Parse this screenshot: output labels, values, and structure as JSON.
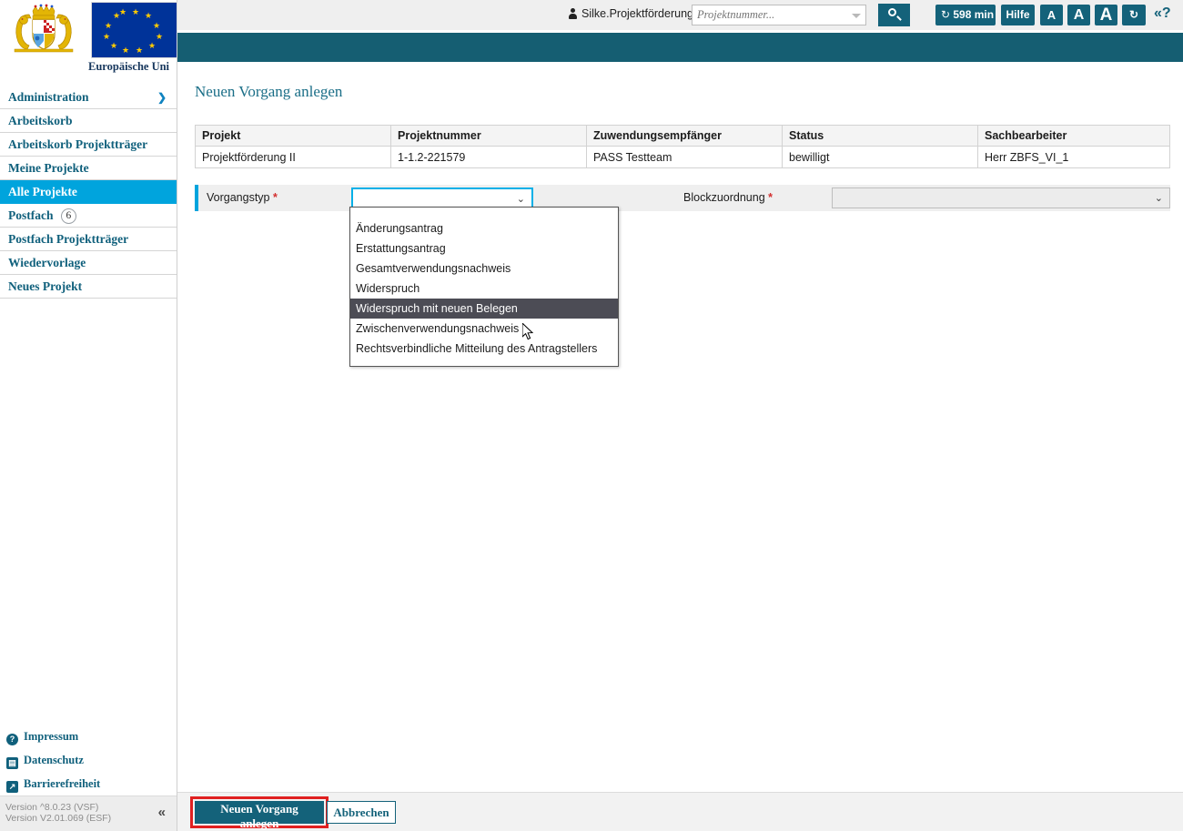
{
  "branding": {
    "eu_caption": "Europäische Uni",
    "crest_alt": "bavaria-coat-of-arms",
    "flag_alt": "eu-flag"
  },
  "topbar": {
    "user_name": "Silke.Projektförderung",
    "search_placeholder": "Projektnummer...",
    "search_value": "",
    "search_button_icon": "search-icon",
    "session_timer": "598 min",
    "help_label": "Hilfe",
    "font_small": "A",
    "font_medium": "A",
    "font_large": "A",
    "refresh_icon": "↻",
    "timer_icon": "↻",
    "collapse_help": "«?"
  },
  "sidebar": {
    "items": [
      {
        "label": "Administration",
        "badge": "",
        "chevron": "❯",
        "active": false
      },
      {
        "label": "Arbeitskorb",
        "badge": "",
        "chevron": "",
        "active": false
      },
      {
        "label": "Arbeitskorb Projektträger",
        "badge": "",
        "chevron": "",
        "active": false
      },
      {
        "label": "Meine Projekte",
        "badge": "",
        "chevron": "",
        "active": false
      },
      {
        "label": "Alle Projekte",
        "badge": "",
        "chevron": "",
        "active": true
      },
      {
        "label": "Postfach",
        "badge": "6",
        "chevron": "",
        "active": false
      },
      {
        "label": "Postfach Projektträger",
        "badge": "",
        "chevron": "",
        "active": false
      },
      {
        "label": "Wiedervorlage",
        "badge": "",
        "chevron": "",
        "active": false
      },
      {
        "label": "Neues Projekt",
        "badge": "",
        "chevron": "",
        "active": false
      }
    ],
    "footer_links": [
      {
        "label": "Impressum",
        "icon": "question-mark-icon",
        "glyph": "?"
      },
      {
        "label": "Datenschutz",
        "icon": "document-lock-icon",
        "glyph": "▤"
      },
      {
        "label": "Barrierefreiheit",
        "icon": "accessibility-arrow-icon",
        "glyph": "↗"
      }
    ],
    "version_line1": "Version ^8.0.23 (VSF)",
    "version_line2": "Version V2.01.069 (ESF)",
    "collapse_icon": "«"
  },
  "main": {
    "page_title": "Neuen Vorgang anlegen",
    "table": {
      "columns": [
        "Projekt",
        "Projektnummer",
        "Zuwendungsempfänger",
        "Status",
        "Sachbearbeiter"
      ],
      "rows": [
        [
          "Projektförderung II",
          "1-1.2-221579",
          "PASS Testteam",
          "bewilligt",
          "Herr ZBFS_VI_1"
        ]
      ]
    },
    "form": {
      "vorgangstyp_label": "Vorgangstyp",
      "vorgangstyp_required": "*",
      "vorgangstyp_value": "",
      "blockzuordnung_label": "Blockzuordnung",
      "blockzuordnung_required": "*",
      "blockzuordnung_value": "",
      "caret": "⌄"
    },
    "dropdown": {
      "options": [
        "Änderungsantrag",
        "Erstattungsantrag",
        "Gesamtverwendungsnachweis",
        "Widerspruch",
        "Widerspruch mit neuen Belegen",
        "Zwischenverwendungsnachweis",
        "Rechtsverbindliche Mitteilung des Antragstellers"
      ],
      "selected_index": 4
    }
  },
  "actions": {
    "primary_label": "Neuen Vorgang anlegen",
    "cancel_label": "Abbrechen",
    "highlight_color": "#e02020"
  },
  "colors": {
    "teal": "#155e72",
    "cyan": "#00a4dd",
    "accent_button": "#14627a",
    "required": "#d32f2f",
    "dropdown_highlight": "#4c4c55"
  }
}
